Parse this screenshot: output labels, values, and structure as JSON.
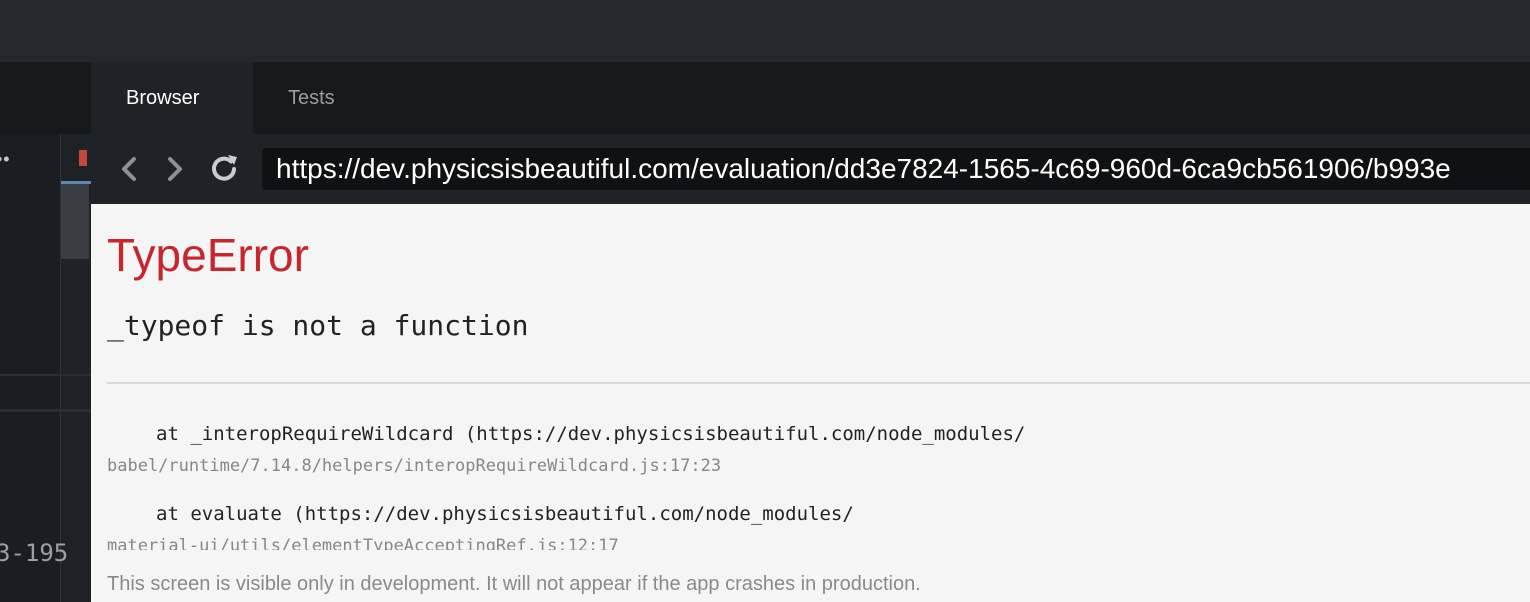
{
  "left_pane": {
    "more_glyph": "••",
    "code_fragment": "3-195"
  },
  "tabs": [
    {
      "label": "Browser",
      "active": true
    },
    {
      "label": "Tests",
      "active": false
    }
  ],
  "nav": {
    "back_icon": "chevron-left-icon",
    "forward_icon": "chevron-right-icon",
    "reload_icon": "reload-icon",
    "url": "https://dev.physicsisbeautiful.com/evaluation/dd3e7824-1565-4c69-960d-6ca9cb561906/b993e"
  },
  "error": {
    "title": "TypeError",
    "message": "_typeof is not a function",
    "stack": [
      {
        "call": "at _interopRequireWildcard (https://dev.physicsisbeautiful.com/node_modules/",
        "path": "babel/runtime/7.14.8/helpers/interopRequireWildcard.js:17:23"
      },
      {
        "call": "at evaluate (https://dev.physicsisbeautiful.com/node_modules/",
        "path": "material-ui/utils/elementTypeAcceptingRef.js:12:17"
      }
    ],
    "footer": "This screen is visible only in development. It will not appear if the app crashes in production."
  },
  "colors": {
    "error_red": "#c8252c",
    "tab_active_bg": "#1f2226",
    "content_bg": "#f5f5f5"
  }
}
